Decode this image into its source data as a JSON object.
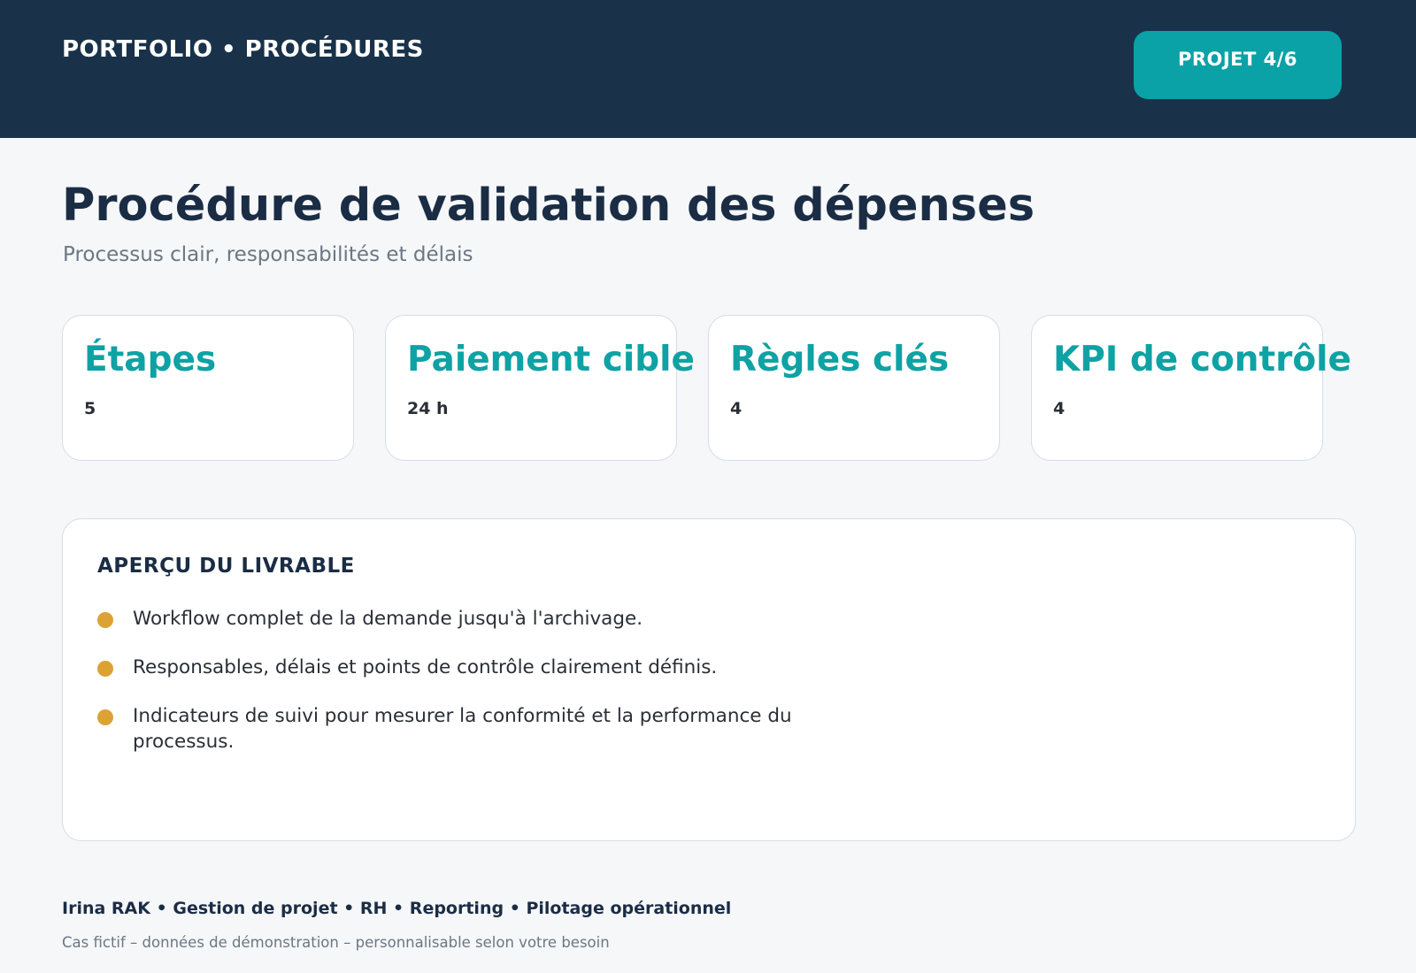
{
  "header": {
    "section_title": "PORTFOLIO • PROCÉDURES",
    "project_badge": "PROJET 4/6",
    "background_color": "#19324a",
    "accent_color": "#0aa2a6"
  },
  "main": {
    "title": "Procédure de validation des dépenses",
    "subtitle": "Processus clair, responsabilités et délais"
  },
  "stats": [
    {
      "label": "Étapes",
      "value": "5"
    },
    {
      "label": "Paiement cible",
      "value": "24 h"
    },
    {
      "label": "Règles clés",
      "value": "4"
    },
    {
      "label": "KPI de contrôle",
      "value": "4"
    }
  ],
  "preview": {
    "heading": "APERÇU DU LIVRABLE",
    "bullet_color": "#dca233",
    "items": [
      "Workflow complet de la demande jusqu'à l'archivage.",
      "Responsables, délais et points de contrôle clairement définis.",
      "Indicateurs de suivi pour mesurer la conformité et la performance du processus."
    ]
  },
  "footer": {
    "credits": "Irina RAK • Gestion de projet • RH • Reporting • Pilotage opérationnel",
    "note": "Cas fictif – données de démonstration – personnalisable selon votre besoin"
  }
}
